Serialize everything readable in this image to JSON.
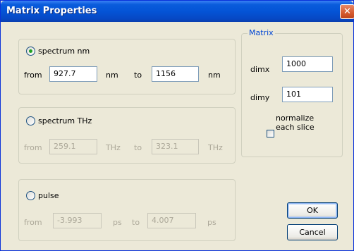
{
  "window": {
    "title": "Matrix Properties",
    "close_glyph": "✕"
  },
  "spectrum_nm": {
    "label": "spectrum nm",
    "selected": true,
    "from_label": "from",
    "from_value": "927.7",
    "unit1": "nm",
    "to_label": "to",
    "to_value": "1156",
    "unit2": "nm"
  },
  "spectrum_thz": {
    "label": "spectrum THz",
    "selected": false,
    "from_label": "from",
    "from_value": "259.1",
    "unit1": "THz",
    "to_label": "to",
    "to_value": "323.1",
    "unit2": "THz"
  },
  "pulse": {
    "label": "pulse",
    "selected": false,
    "from_label": "from",
    "from_value": "-3.993",
    "unit1": "ps",
    "to_label": "to",
    "to_value": "4.007",
    "unit2": "ps"
  },
  "matrix": {
    "legend": "Matrix",
    "dimx_label": "dimx",
    "dimx_value": "1000",
    "dimy_label": "dimy",
    "dimy_value": "101",
    "normalize_line1": "normalize",
    "normalize_line2": "each slice",
    "normalize_checked": false
  },
  "buttons": {
    "ok": "OK",
    "cancel": "Cancel"
  }
}
